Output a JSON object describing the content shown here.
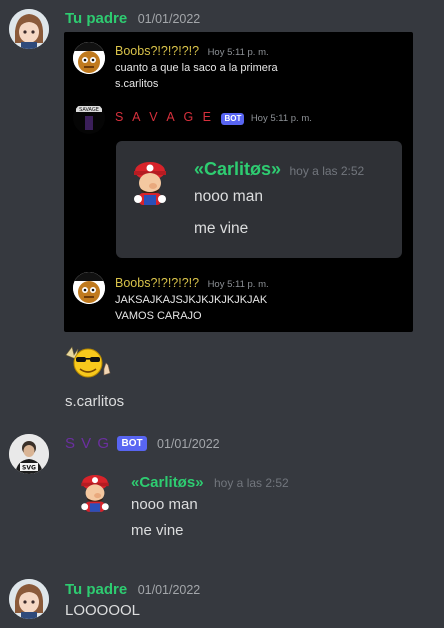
{
  "messages": [
    {
      "author": "Tu padre",
      "date": "01/01/2022",
      "screenshot": {
        "m1": {
          "author": "Boobs?!?!?!?!?",
          "time": "Hoy 5:11 p. m.",
          "lines": [
            "cuanto a que la saco a la primera",
            "s.carlitos"
          ]
        },
        "m2": {
          "author": "S A V A G E",
          "badge": "BOT",
          "time": "Hoy 5:11 p. m.",
          "avatar_text": "SAVAGE",
          "quote": {
            "author": "«Carlitøs»",
            "time": "hoy a las 2:52",
            "lines": [
              "nooo man",
              "me vine"
            ]
          }
        },
        "m3": {
          "author": "Boobs?!?!?!?!?",
          "time": "Hoy 5:11 p. m.",
          "lines": [
            "JAKSAJKAJSJKJKJKJKJKJAK",
            "VAMOS CARAJO"
          ]
        }
      },
      "sticker": "cool-emoji-thumbs-up",
      "text": "s.carlitos"
    },
    {
      "author": "S V G",
      "badge": "BOT",
      "date": "01/01/2022",
      "avatar_text": "SVG",
      "quote": {
        "author": "«Carlitøs»",
        "time": "hoy a las 2:52",
        "lines": [
          "nooo man",
          "me vine"
        ]
      }
    },
    {
      "author": "Tu padre",
      "date": "01/01/2022",
      "text": "LOOOOOL"
    }
  ],
  "colors": {
    "background": "#36393f",
    "green_name": "#2ecc71",
    "bot_badge": "#5865f2",
    "savage_red": "#d6303c",
    "svg_purple": "#6b2fa0"
  }
}
